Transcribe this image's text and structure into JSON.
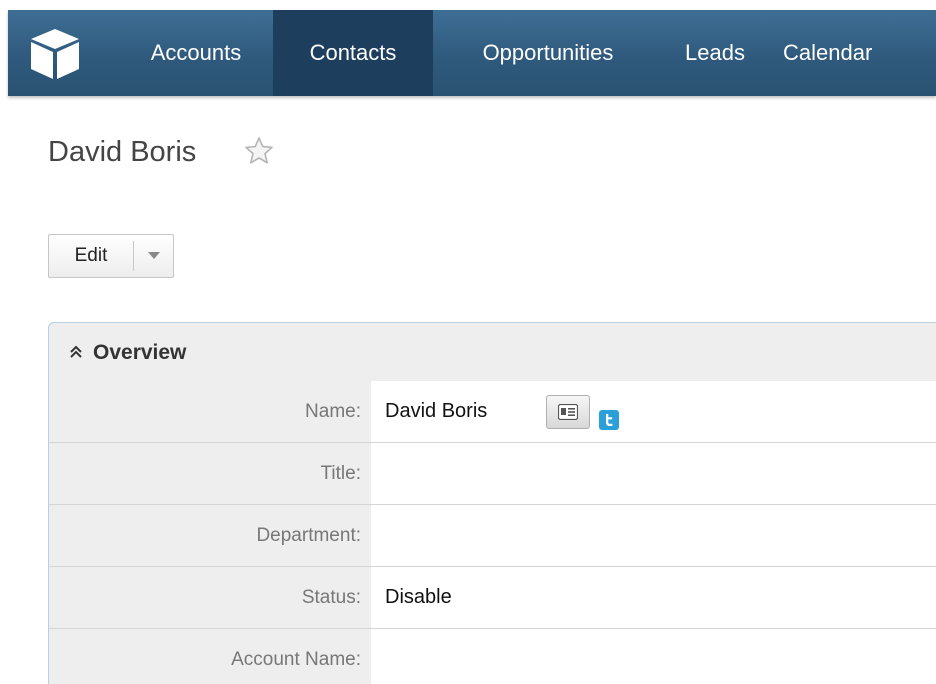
{
  "nav": {
    "logo": "cube-logo-icon",
    "items": [
      {
        "label": "Accounts",
        "active": false
      },
      {
        "label": "Contacts",
        "active": true
      },
      {
        "label": "Opportunities",
        "active": false
      },
      {
        "label": "Leads",
        "active": false
      },
      {
        "label": "Calendar",
        "active": false
      }
    ]
  },
  "record": {
    "title": "David Boris",
    "favorite_icon": "star-outline-icon"
  },
  "actions": {
    "edit_label": "Edit",
    "dropdown_icon": "caret-down-icon"
  },
  "panel": {
    "title": "Overview",
    "collapse_icon": "double-chevron-up-icon",
    "fields": [
      {
        "label": "Name:",
        "value": "David Boris",
        "icons": [
          "vcard-icon",
          "twitter-icon"
        ]
      },
      {
        "label": "Title:",
        "value": ""
      },
      {
        "label": "Department:",
        "value": ""
      },
      {
        "label": "Status:",
        "value": "Disable"
      },
      {
        "label": "Account Name:",
        "value": ""
      }
    ]
  },
  "colors": {
    "nav_bg": "#2f5a7d",
    "nav_active": "#1d3e5c",
    "panel_border": "#b9cfe0",
    "twitter": "#2a9fd8"
  }
}
